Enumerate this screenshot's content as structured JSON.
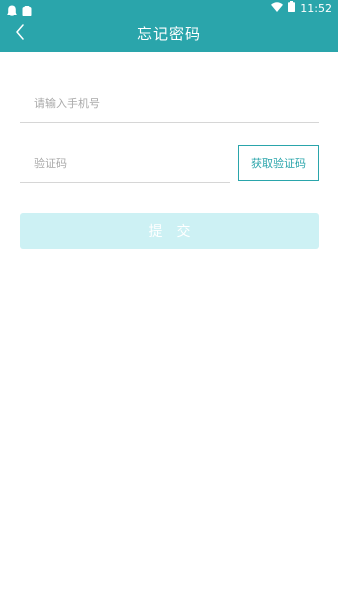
{
  "status_bar": {
    "time": "11:52",
    "icons": [
      "notification-icon",
      "app-icon",
      "wifi-icon",
      "battery-icon"
    ]
  },
  "header": {
    "title": "忘记密码",
    "back_icon": "chevron-left-icon"
  },
  "form": {
    "phone_placeholder": "请输入手机号",
    "code_placeholder": "验证码",
    "get_code_label": "获取验证码",
    "submit_label": "提交"
  },
  "colors": {
    "primary": "#2aa5ab",
    "submit_disabled": "#cdf1f4",
    "divider": "#d6d6d6",
    "placeholder": "#a9a9a9"
  }
}
